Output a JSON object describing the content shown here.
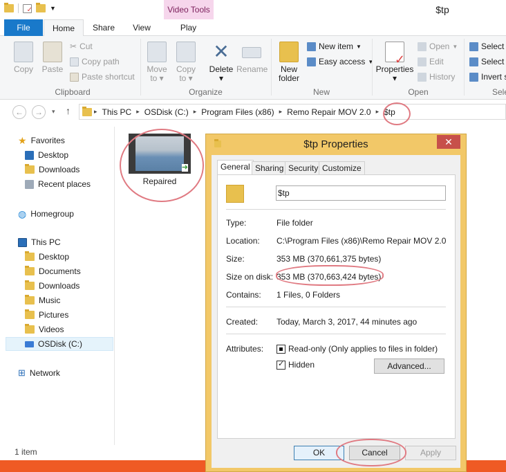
{
  "title_bar": {
    "context_tab": "Video Tools",
    "window_title": "$tp"
  },
  "tabs": {
    "file": "File",
    "home": "Home",
    "share": "Share",
    "view": "View",
    "play": "Play"
  },
  "ribbon": {
    "copy": "Copy",
    "paste": "Paste",
    "cut": "Cut",
    "copy_path": "Copy path",
    "paste_shortcut": "Paste shortcut",
    "clipboard": "Clipboard",
    "move_to": "Move",
    "move_to2": "to",
    "copy_to": "Copy",
    "copy_to2": "to",
    "delete": "Delete",
    "rename": "Rename",
    "organize": "Organize",
    "new_folder": "New",
    "new_folder2": "folder",
    "new_item": "New item",
    "easy_access": "Easy access",
    "new": "New",
    "properties": "Properties",
    "open": "Open",
    "edit": "Edit",
    "history": "History",
    "open_group": "Open",
    "select_all": "Select",
    "select_none": "Select",
    "invert": "Invert s",
    "select_group": "Sele"
  },
  "address": {
    "items": [
      "This PC",
      "OSDisk (C:)",
      "Program Files (x86)",
      "Remo Repair MOV 2.0",
      "$tp"
    ]
  },
  "nav": {
    "favorites": "Favorites",
    "desktop": "Desktop",
    "downloads": "Downloads",
    "recent": "Recent places",
    "homegroup": "Homegroup",
    "this_pc": "This PC",
    "pc_desktop": "Desktop",
    "documents": "Documents",
    "pc_downloads": "Downloads",
    "music": "Music",
    "pictures": "Pictures",
    "videos": "Videos",
    "osdisk": "OSDisk (C:)",
    "network": "Network"
  },
  "content": {
    "file_name": "Repaired"
  },
  "status": {
    "count": "1 item"
  },
  "dialog": {
    "title": "$tp Properties",
    "tabs": [
      "General",
      "Sharing",
      "Security",
      "Customize"
    ],
    "name_value": "$tp",
    "type_label": "Type:",
    "type_value": "File folder",
    "location_label": "Location:",
    "location_value": "C:\\Program Files (x86)\\Remo Repair MOV 2.0",
    "size_label": "Size:",
    "size_value": "353 MB (370,661,375 bytes)",
    "size_disk_label": "Size on disk:",
    "size_disk_value": "353 MB (370,663,424 bytes)",
    "contains_label": "Contains:",
    "contains_value": "1 Files, 0 Folders",
    "created_label": "Created:",
    "created_value": "Today, March 3, 2017, 44 minutes ago",
    "attributes_label": "Attributes:",
    "readonly": "Read-only (Only applies to files in folder)",
    "hidden": "Hidden",
    "advanced": "Advanced...",
    "ok": "OK",
    "cancel": "Cancel",
    "apply": "Apply"
  },
  "colors": {
    "accent": "#1979ca",
    "annotation": "#e07a82",
    "dialog_frame": "#f2c868"
  }
}
